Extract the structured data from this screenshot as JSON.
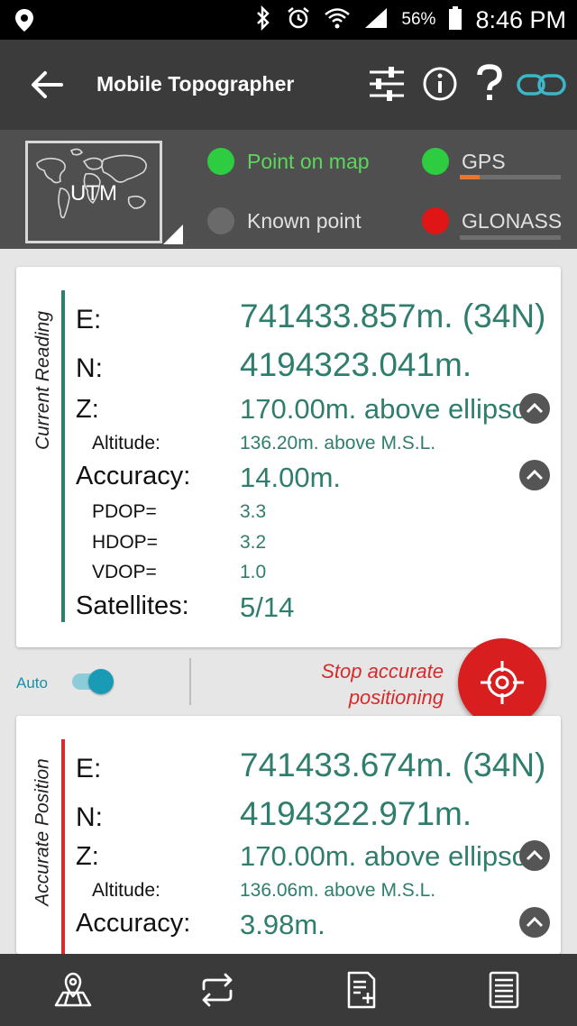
{
  "status_bar": {
    "battery": "56%",
    "time": "8:46 PM"
  },
  "app_bar": {
    "title": "Mobile Topographer"
  },
  "header": {
    "map_label": "UTM",
    "point_on_map": "Point on map",
    "known_point": "Known point",
    "gps": "GPS",
    "glonass": "GLONASS",
    "gps_signal": 0.2,
    "glonass_signal": 0,
    "colors": {
      "active": "#2ecc40",
      "inactive": "#6a6a6a",
      "error": "#e01515",
      "active_text": "#5cd65c",
      "inactive_text": "#e0e0e0"
    }
  },
  "current_reading": {
    "section_label": "Current Reading",
    "accent_color": "#2f7d6c",
    "e_label": "E:",
    "e_value": "741433.857m. (34N)",
    "n_label": "N:",
    "n_value": "4194323.041m.",
    "z_label": "Z:",
    "z_value": "170.00m. above ellipso",
    "altitude_label": "Altitude:",
    "altitude_value": "136.20m. above M.S.L.",
    "accuracy_label": "Accuracy:",
    "accuracy_value": "14.00m.",
    "pdop_label": "PDOP=",
    "pdop_value": "3.3",
    "hdop_label": "HDOP=",
    "hdop_value": "3.2",
    "vdop_label": "VDOP=",
    "vdop_value": "1.0",
    "satellites_label": "Satellites:",
    "satellites_value": "5/14"
  },
  "controls": {
    "auto_label": "Auto",
    "stop_line1": "Stop accurate",
    "stop_line2": "positioning"
  },
  "accurate_position": {
    "section_label": "Accurate Position",
    "accent_color": "#d52b2b",
    "e_label": "E:",
    "e_value": "741433.674m. (34N)",
    "n_label": "N:",
    "n_value": "4194322.971m.",
    "z_label": "Z:",
    "z_value": "170.00m. above ellipso",
    "altitude_label": "Altitude:",
    "altitude_value": "136.06m. above M.S.L.",
    "accuracy_label": "Accuracy:",
    "accuracy_value": "3.98m."
  }
}
